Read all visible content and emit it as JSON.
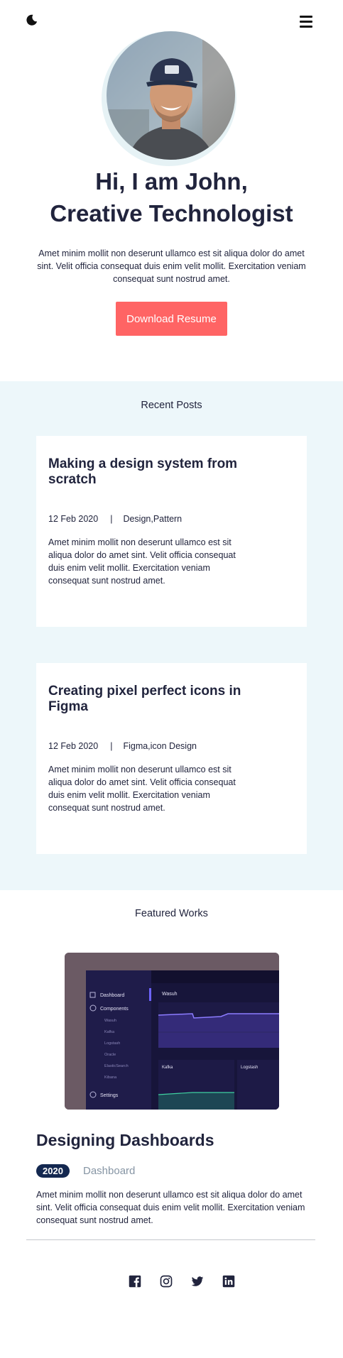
{
  "header": {
    "theme_toggle_icon": "moon-icon",
    "menu_icon": "hamburger-menu-icon"
  },
  "hero": {
    "title_line1": "Hi, I am John,",
    "title_line2": "Creative Technologist",
    "intro": "Amet minim mollit non deserunt ullamco est sit aliqua dolor do amet sint. Velit officia consequat duis enim velit mollit. Exercitation veniam consequat sunt nostrud amet.",
    "button_label": "Download Resume",
    "button_color": "#ff6464"
  },
  "recent_posts": {
    "heading": "Recent Posts",
    "posts": [
      {
        "title": "Making a design system from scratch",
        "date": "12 Feb 2020",
        "separator": "|",
        "tags": "Design,Pattern",
        "excerpt": "Amet minim mollit non deserunt ullamco est sit aliqua dolor do amet sint. Velit officia consequat duis enim velit mollit. Exercitation veniam consequat sunt nostrud amet."
      },
      {
        "title": "Creating pixel perfect icons in Figma",
        "date": "12 Feb 2020",
        "separator": "|",
        "tags": "Figma,icon Design",
        "excerpt": "Amet minim mollit non deserunt ullamco est sit aliqua dolor do amet sint. Velit officia consequat duis enim velit mollit. Exercitation veniam consequat sunt nostrud amet."
      }
    ]
  },
  "featured_works": {
    "heading": "Featured Works",
    "works": [
      {
        "title": "Designing Dashboards",
        "year": "2020",
        "tag": "Dashboard",
        "description": "Amet minim mollit non deserunt ullamco est sit aliqua dolor do amet sint. Velit officia consequat duis enim velit mollit. Exercitation veniam consequat sunt nostrud amet.",
        "thumbnail": {
          "nav_items": [
            "Dashboard",
            "Components",
            "Wasuh",
            "Kafka",
            "Logstash",
            "Oracle",
            "ElasticSearch",
            "Kibana",
            "Settings"
          ],
          "panel_titles": [
            "Wasuh",
            "Kafka",
            "Logstash"
          ]
        }
      }
    ]
  },
  "footer": {
    "social_icons": [
      "facebook-icon",
      "instagram-icon",
      "twitter-icon",
      "linkedin-icon"
    ]
  },
  "colors": {
    "text": "#21243d",
    "accent": "#ff6464",
    "section_bg": "#edf7fa",
    "badge": "#142850",
    "muted": "#8695a4"
  }
}
